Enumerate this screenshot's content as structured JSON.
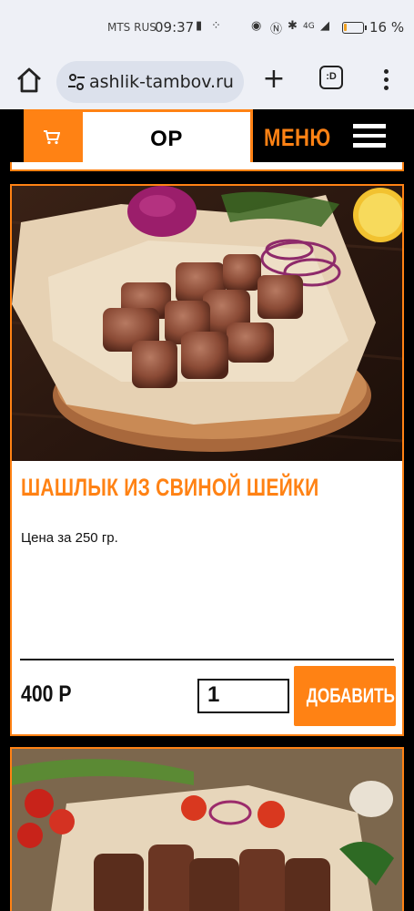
{
  "status_bar": {
    "carrier": "MTS RUS",
    "time": "09:37",
    "network": "4G",
    "battery_percent_text": "16 %",
    "battery_level": 0.16
  },
  "browser": {
    "url": "ashlik-tambov.ru",
    "tabs_label": ":D",
    "icons": [
      "home-icon",
      "site-settings-icon",
      "new-tab-icon",
      "tab-switcher-icon",
      "overflow-menu-icon"
    ]
  },
  "site_header": {
    "search_text": "ОР",
    "menu_label": "МЕНЮ",
    "icons": [
      "cart-icon",
      "hamburger-icon"
    ],
    "colors": {
      "accent": "#ff8214",
      "header_bg": "#000000"
    }
  },
  "products": [
    {
      "title": "ШАШЛЫК ИЗ СВИНОЙ ШЕЙКИ",
      "description": "Цена за 250 гр.",
      "price": "400 Р",
      "quantity": "1",
      "add_label": "ДОБАВИТЬ",
      "image": "pork-neck-shashlik-photo"
    },
    {
      "image": "shashlik-with-tomatoes-photo"
    }
  ]
}
